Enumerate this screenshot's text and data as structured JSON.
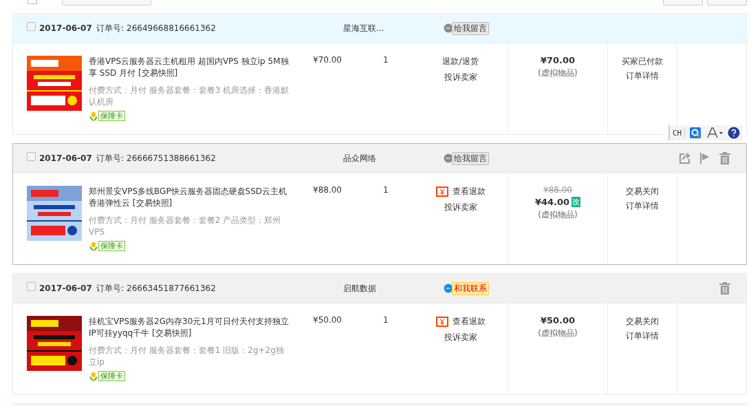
{
  "select_all": {
    "checked": false
  },
  "orders": [
    {
      "kind": "paid",
      "hovered": false,
      "checked": false,
      "date": "2017-06-07",
      "order_label": "订单号:",
      "order_no": "26649668816661362",
      "shop": "星海互联...",
      "contact": {
        "kind": "message",
        "label": "给我留言"
      },
      "tools": {
        "share": false,
        "flag": false,
        "delete": false
      },
      "item": {
        "title": "香港VPS云服务器云主机租用 超国内VPS 独立ip 5M独享 SSD 月付",
        "snapshot": "[交易快照]",
        "options": "付费方式：月付  服务器套餐：套餐3  机房选择：香港默认机房",
        "guarantee": "保障卡",
        "price": "¥70.00",
        "qty": "1",
        "actions": [
          {
            "label": "退款/退货",
            "refund_icon": false
          },
          {
            "label": "投诉卖家",
            "refund_icon": false
          }
        ],
        "total": "¥70.00",
        "total_note": "(虚拟物品)",
        "status": "买家已付款",
        "detail": "订单详情"
      }
    },
    {
      "kind": "closed",
      "hovered": true,
      "checked": false,
      "date": "2017-06-07",
      "order_label": "订单号:",
      "order_no": "26666751388661362",
      "shop": "品众网络",
      "contact": {
        "kind": "message",
        "label": "给我留言"
      },
      "tools": {
        "share": true,
        "flag": true,
        "delete": true
      },
      "item": {
        "title": "郑州景安VPS多线BGP快云服务器固态硬盘SSD云主机香港弹性云",
        "snapshot": "[交易快照]",
        "options": "付费方式：月付  服务器套餐：套餐2  产品类型：郑州VPS",
        "guarantee": "保障卡",
        "price": "¥88.00",
        "qty": "1",
        "actions": [
          {
            "label": "查看退款",
            "refund_icon": true
          },
          {
            "label": "投诉卖家",
            "refund_icon": false
          }
        ],
        "original_total": "¥88.00",
        "total": "¥44.00",
        "modified": "改",
        "total_note": "(虚拟物品)",
        "status": "交易关闭",
        "detail": "订单详情"
      }
    },
    {
      "kind": "closed",
      "hovered": false,
      "checked": false,
      "date": "2017-06-07",
      "order_label": "订单号:",
      "order_no": "26663451877661362",
      "shop": "启航数据",
      "contact": {
        "kind": "contact",
        "label": "和我联系"
      },
      "tools": {
        "share": false,
        "flag": false,
        "delete": true
      },
      "item": {
        "title": "挂机宝VPS服务器2G内存30元1月可日付天付支持独立IP可挂yyqq千牛",
        "snapshot": "[交易快照]",
        "options": "付费方式：月付  服务器套餐：套餐1  旧版：2g+2g独立ip",
        "guarantee": "保障卡",
        "price": "¥50.00",
        "qty": "1",
        "actions": [
          {
            "label": "查看退款",
            "refund_icon": true
          },
          {
            "label": "投诉卖家",
            "refund_icon": false
          }
        ],
        "total": "¥50.00",
        "total_note": "(虚拟物品)",
        "status": "交易关闭",
        "detail": "订单详情"
      }
    }
  ],
  "ime_toolbar": {
    "language": "CH"
  }
}
